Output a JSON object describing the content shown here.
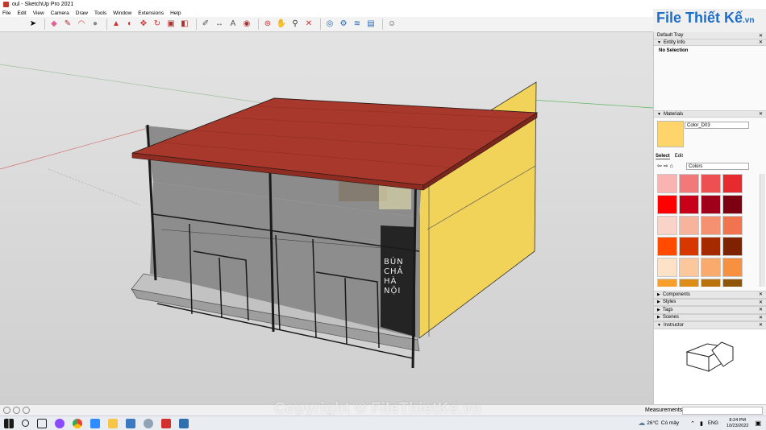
{
  "window": {
    "title": "oul - SketchUp Pro 2021"
  },
  "menu": [
    "File",
    "Edit",
    "View",
    "Camera",
    "Draw",
    "Tools",
    "Window",
    "Extensions",
    "Help"
  ],
  "toolbar": {
    "tools": [
      "select-arrow-icon",
      "eraser-icon",
      "pencil-icon",
      "freehand-icon",
      "arc-icon",
      "shape-icon",
      "pushpull-icon",
      "followme-icon",
      "move-icon",
      "rotate-icon",
      "scale-icon",
      "offset-icon",
      "tape-icon",
      "dimension-icon",
      "protractor-icon",
      "text-icon",
      "axes-icon",
      "3dtext-icon",
      "paint-icon",
      "orbit-icon",
      "pan-icon",
      "zoom-icon",
      "zoom-extents-icon",
      "warehouse-icon",
      "extension-icon",
      "sandbox-icon",
      "layout-icon",
      "user-icon"
    ]
  },
  "logo": {
    "text": "File Thiết Kế",
    "suffix": ".vn"
  },
  "tray": {
    "title": "Default Tray",
    "entity_info": {
      "label": "Entity Info",
      "selection": "No Selection"
    },
    "materials": {
      "label": "Materials",
      "current_name": "Color_D03",
      "current_color": "#ffd56b",
      "tabs": [
        "Select",
        "Edit"
      ],
      "library": "Colors",
      "swatches": [
        "#f9b3b0",
        "#f2787a",
        "#ee4f50",
        "#e62a2d",
        "#ff0000",
        "#c8001a",
        "#a0001a",
        "#7d0010",
        "#f9d2c8",
        "#f7b39b",
        "#f59070",
        "#f2744f",
        "#ff4a00",
        "#d83800",
        "#a52a00",
        "#7f2200",
        "#fde2c8",
        "#fbc79b",
        "#f9ab6e",
        "#f79140",
        "#f79f2c",
        "#dd8e16",
        "#b8730c",
        "#8e5508"
      ]
    },
    "collapsed": [
      "Components",
      "Styles",
      "Tags",
      "Scenes"
    ],
    "instructor": {
      "label": "Instructor"
    }
  },
  "status": {
    "measurements_label": "Measurements"
  },
  "storefront": {
    "sign_lines": [
      "BÚN",
      "CHẢ",
      "HÀ",
      "NỘI"
    ]
  },
  "taskbar": {
    "weather": "26°C",
    "weather_desc": "Có mây",
    "lang": "ENG",
    "time": "8:24 PM",
    "date": "10/23/2022"
  },
  "watermark": "Copyright © FileThietKe.vn"
}
